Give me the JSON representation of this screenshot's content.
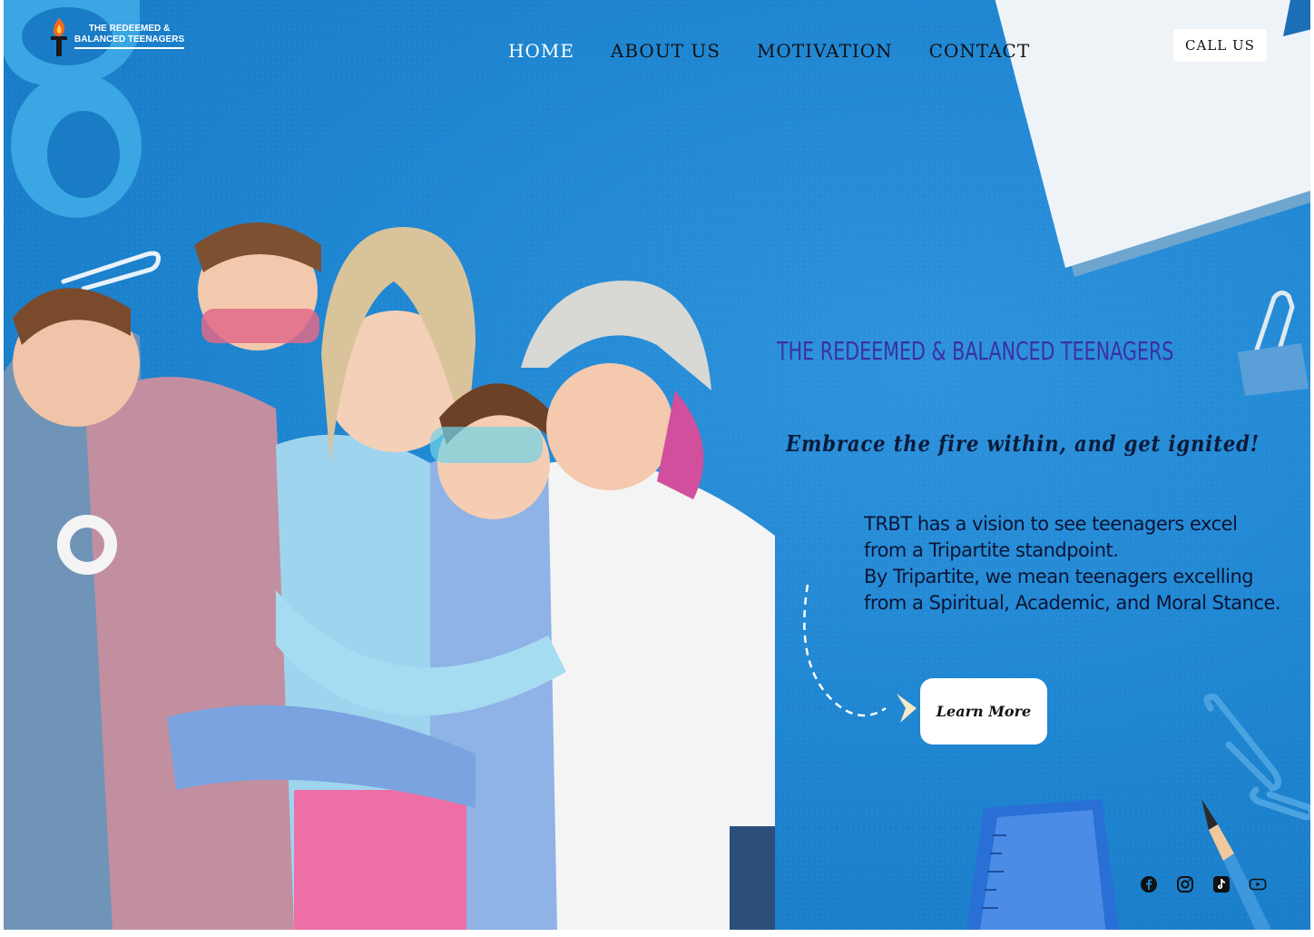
{
  "logo": {
    "line1": "THE REDEEMED &",
    "line2": "BALANCED TEENAGERS"
  },
  "nav": {
    "items": [
      {
        "label": "HOME",
        "active": true
      },
      {
        "label": "ABOUT US",
        "active": false
      },
      {
        "label": "MOTIVATION",
        "active": false
      },
      {
        "label": "CONTACT",
        "active": false
      }
    ],
    "call_label": "CALL US"
  },
  "hero": {
    "title": "THE REDEEMED & BALANCED TEENAGERS",
    "tagline": "Embrace the fire within, and get ignited!",
    "vision_p1": "TRBT has a vision to see teenagers excel from a Tripartite standpoint.",
    "vision_p2": "By Tripartite, we mean teenagers excelling from a Spiritual, Academic, and Moral Stance.",
    "cta_label": "Learn More"
  },
  "socials": [
    "facebook-icon",
    "instagram-icon",
    "tiktok-icon",
    "youtube-icon"
  ],
  "colors": {
    "background": "#1f86d2",
    "title": "#3b2fa6",
    "text": "#0c1535",
    "button_bg": "#ffffff"
  }
}
